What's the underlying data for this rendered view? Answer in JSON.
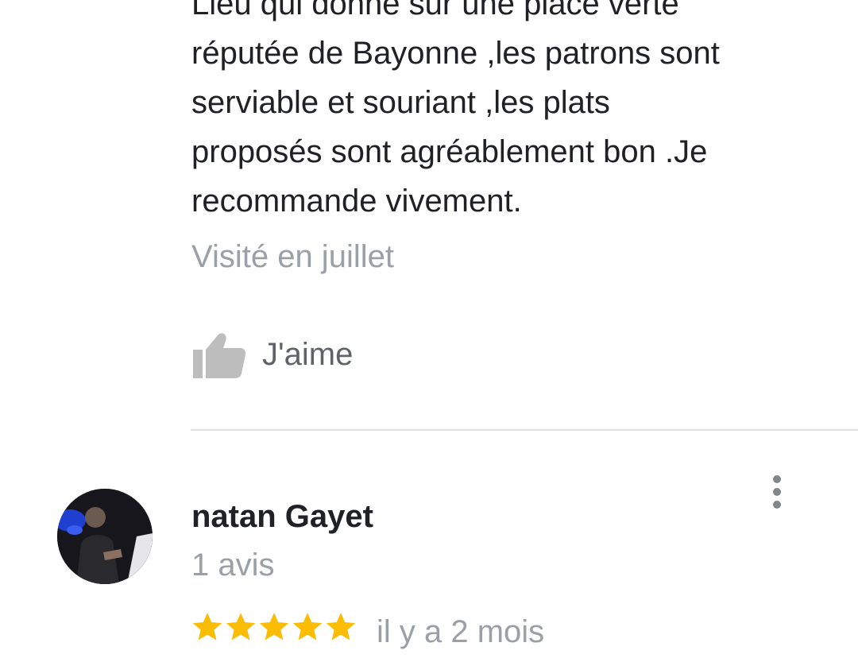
{
  "previous_review": {
    "text": "Lieu qui donne sur une place verte\nréputée de Bayonne ,les patrons sont\nserviable et souriant ,les plats\nproposés sont agréablement bon .Je\nrecommande vivement.",
    "visit_info": "Visité en juillet",
    "like_label": "J'aime",
    "like_icon": "thumb-up-icon"
  },
  "next_review": {
    "reviewer_name": "natan Gayet",
    "review_count": "1 avis",
    "rating": 5,
    "date": "il y a 2 mois",
    "more_icon": "more-vert-icon"
  },
  "colors": {
    "text_primary": "#202124",
    "text_secondary": "#9aa0a6",
    "icon_gray": "#bdbdbd",
    "star_gold": "#fbbc04",
    "divider": "#e0e0e0"
  }
}
